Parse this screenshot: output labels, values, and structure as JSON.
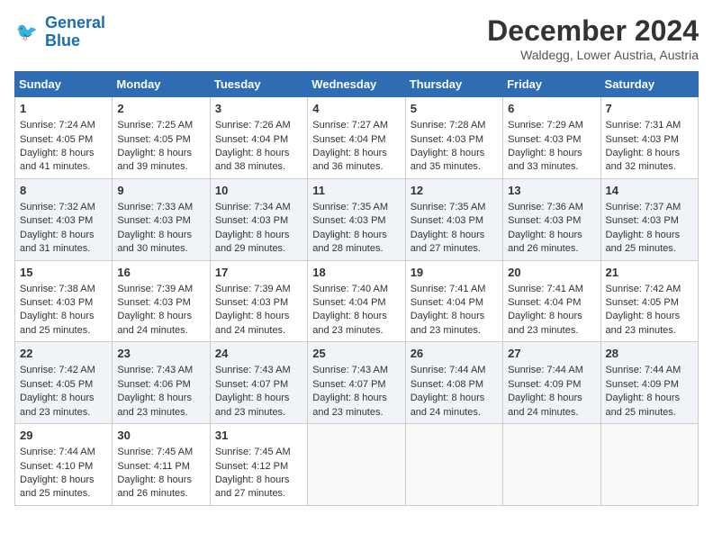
{
  "header": {
    "logo_line1": "General",
    "logo_line2": "Blue",
    "title": "December 2024",
    "subtitle": "Waldegg, Lower Austria, Austria"
  },
  "weekdays": [
    "Sunday",
    "Monday",
    "Tuesday",
    "Wednesday",
    "Thursday",
    "Friday",
    "Saturday"
  ],
  "weeks": [
    [
      {
        "day": "1",
        "lines": [
          "Sunrise: 7:24 AM",
          "Sunset: 4:05 PM",
          "Daylight: 8 hours",
          "and 41 minutes."
        ]
      },
      {
        "day": "2",
        "lines": [
          "Sunrise: 7:25 AM",
          "Sunset: 4:05 PM",
          "Daylight: 8 hours",
          "and 39 minutes."
        ]
      },
      {
        "day": "3",
        "lines": [
          "Sunrise: 7:26 AM",
          "Sunset: 4:04 PM",
          "Daylight: 8 hours",
          "and 38 minutes."
        ]
      },
      {
        "day": "4",
        "lines": [
          "Sunrise: 7:27 AM",
          "Sunset: 4:04 PM",
          "Daylight: 8 hours",
          "and 36 minutes."
        ]
      },
      {
        "day": "5",
        "lines": [
          "Sunrise: 7:28 AM",
          "Sunset: 4:03 PM",
          "Daylight: 8 hours",
          "and 35 minutes."
        ]
      },
      {
        "day": "6",
        "lines": [
          "Sunrise: 7:29 AM",
          "Sunset: 4:03 PM",
          "Daylight: 8 hours",
          "and 33 minutes."
        ]
      },
      {
        "day": "7",
        "lines": [
          "Sunrise: 7:31 AM",
          "Sunset: 4:03 PM",
          "Daylight: 8 hours",
          "and 32 minutes."
        ]
      }
    ],
    [
      {
        "day": "8",
        "lines": [
          "Sunrise: 7:32 AM",
          "Sunset: 4:03 PM",
          "Daylight: 8 hours",
          "and 31 minutes."
        ]
      },
      {
        "day": "9",
        "lines": [
          "Sunrise: 7:33 AM",
          "Sunset: 4:03 PM",
          "Daylight: 8 hours",
          "and 30 minutes."
        ]
      },
      {
        "day": "10",
        "lines": [
          "Sunrise: 7:34 AM",
          "Sunset: 4:03 PM",
          "Daylight: 8 hours",
          "and 29 minutes."
        ]
      },
      {
        "day": "11",
        "lines": [
          "Sunrise: 7:35 AM",
          "Sunset: 4:03 PM",
          "Daylight: 8 hours",
          "and 28 minutes."
        ]
      },
      {
        "day": "12",
        "lines": [
          "Sunrise: 7:35 AM",
          "Sunset: 4:03 PM",
          "Daylight: 8 hours",
          "and 27 minutes."
        ]
      },
      {
        "day": "13",
        "lines": [
          "Sunrise: 7:36 AM",
          "Sunset: 4:03 PM",
          "Daylight: 8 hours",
          "and 26 minutes."
        ]
      },
      {
        "day": "14",
        "lines": [
          "Sunrise: 7:37 AM",
          "Sunset: 4:03 PM",
          "Daylight: 8 hours",
          "and 25 minutes."
        ]
      }
    ],
    [
      {
        "day": "15",
        "lines": [
          "Sunrise: 7:38 AM",
          "Sunset: 4:03 PM",
          "Daylight: 8 hours",
          "and 25 minutes."
        ]
      },
      {
        "day": "16",
        "lines": [
          "Sunrise: 7:39 AM",
          "Sunset: 4:03 PM",
          "Daylight: 8 hours",
          "and 24 minutes."
        ]
      },
      {
        "day": "17",
        "lines": [
          "Sunrise: 7:39 AM",
          "Sunset: 4:03 PM",
          "Daylight: 8 hours",
          "and 24 minutes."
        ]
      },
      {
        "day": "18",
        "lines": [
          "Sunrise: 7:40 AM",
          "Sunset: 4:04 PM",
          "Daylight: 8 hours",
          "and 23 minutes."
        ]
      },
      {
        "day": "19",
        "lines": [
          "Sunrise: 7:41 AM",
          "Sunset: 4:04 PM",
          "Daylight: 8 hours",
          "and 23 minutes."
        ]
      },
      {
        "day": "20",
        "lines": [
          "Sunrise: 7:41 AM",
          "Sunset: 4:04 PM",
          "Daylight: 8 hours",
          "and 23 minutes."
        ]
      },
      {
        "day": "21",
        "lines": [
          "Sunrise: 7:42 AM",
          "Sunset: 4:05 PM",
          "Daylight: 8 hours",
          "and 23 minutes."
        ]
      }
    ],
    [
      {
        "day": "22",
        "lines": [
          "Sunrise: 7:42 AM",
          "Sunset: 4:05 PM",
          "Daylight: 8 hours",
          "and 23 minutes."
        ]
      },
      {
        "day": "23",
        "lines": [
          "Sunrise: 7:43 AM",
          "Sunset: 4:06 PM",
          "Daylight: 8 hours",
          "and 23 minutes."
        ]
      },
      {
        "day": "24",
        "lines": [
          "Sunrise: 7:43 AM",
          "Sunset: 4:07 PM",
          "Daylight: 8 hours",
          "and 23 minutes."
        ]
      },
      {
        "day": "25",
        "lines": [
          "Sunrise: 7:43 AM",
          "Sunset: 4:07 PM",
          "Daylight: 8 hours",
          "and 23 minutes."
        ]
      },
      {
        "day": "26",
        "lines": [
          "Sunrise: 7:44 AM",
          "Sunset: 4:08 PM",
          "Daylight: 8 hours",
          "and 24 minutes."
        ]
      },
      {
        "day": "27",
        "lines": [
          "Sunrise: 7:44 AM",
          "Sunset: 4:09 PM",
          "Daylight: 8 hours",
          "and 24 minutes."
        ]
      },
      {
        "day": "28",
        "lines": [
          "Sunrise: 7:44 AM",
          "Sunset: 4:09 PM",
          "Daylight: 8 hours",
          "and 25 minutes."
        ]
      }
    ],
    [
      {
        "day": "29",
        "lines": [
          "Sunrise: 7:44 AM",
          "Sunset: 4:10 PM",
          "Daylight: 8 hours",
          "and 25 minutes."
        ]
      },
      {
        "day": "30",
        "lines": [
          "Sunrise: 7:45 AM",
          "Sunset: 4:11 PM",
          "Daylight: 8 hours",
          "and 26 minutes."
        ]
      },
      {
        "day": "31",
        "lines": [
          "Sunrise: 7:45 AM",
          "Sunset: 4:12 PM",
          "Daylight: 8 hours",
          "and 27 minutes."
        ]
      },
      {
        "day": "",
        "lines": []
      },
      {
        "day": "",
        "lines": []
      },
      {
        "day": "",
        "lines": []
      },
      {
        "day": "",
        "lines": []
      }
    ]
  ]
}
